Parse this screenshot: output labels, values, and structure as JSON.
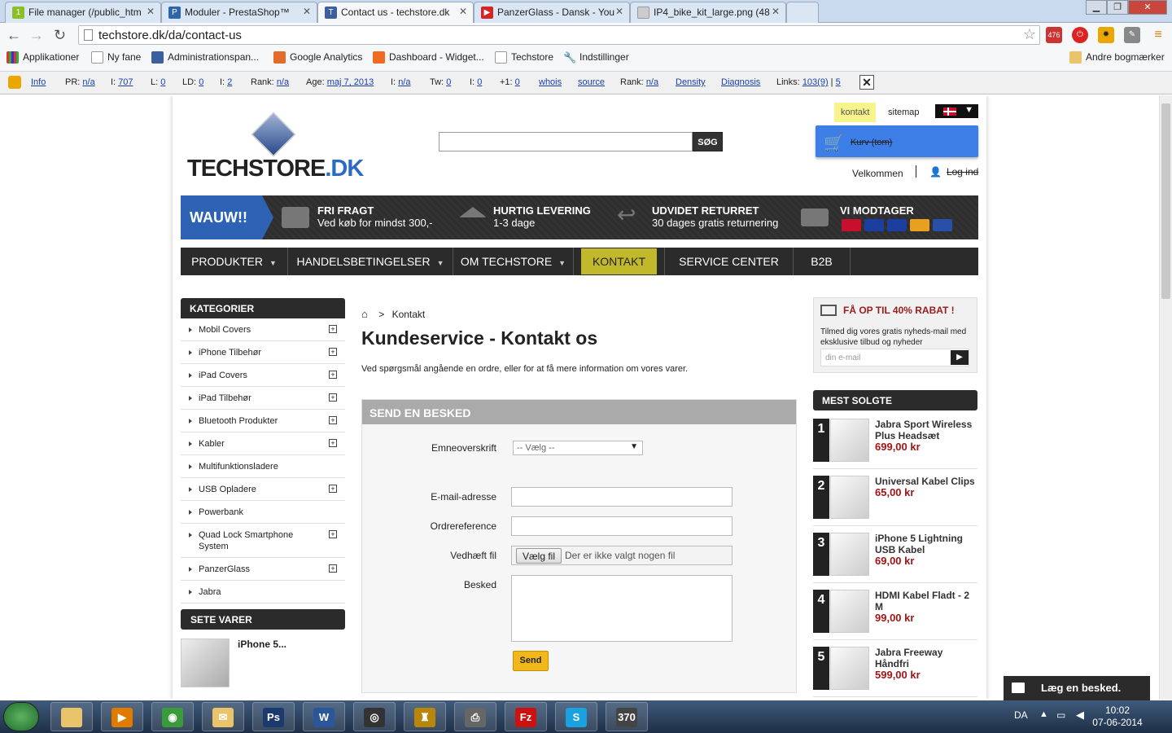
{
  "browser": {
    "tabs": [
      {
        "title": "File manager (/public_htm",
        "fav": "1",
        "color": "#8cbf26"
      },
      {
        "title": "Moduler - PrestaShop™",
        "fav": "P",
        "color": "#2f66a9"
      },
      {
        "title": "Contact us - techstore.dk",
        "fav": "T",
        "color": "#3d5fa0",
        "active": true
      },
      {
        "title": "PanzerGlass - Dansk - You",
        "fav": "▶",
        "color": "#d42424"
      },
      {
        "title": "IP4_bike_kit_large.png (48",
        "fav": "",
        "color": "#cccccc"
      }
    ],
    "url": "techstore.dk/da/contact-us",
    "ext_badge": "476",
    "bookmarks": [
      "Applikationer",
      "Ny fane",
      "Administrationspan...",
      "Google Analytics",
      "Dashboard - Widget...",
      "Techstore",
      "Indstillinger"
    ],
    "other_bookmarks": "Andre bogmærker"
  },
  "seo": {
    "info": "Info",
    "pr_label": "PR:",
    "pr": "n/a",
    "i_label": "I:",
    "i": "707",
    "l_label": "L:",
    "l": "0",
    "ld_label": "LD:",
    "ld": "0",
    "i2_label": "I:",
    "i2": "2",
    "rank_label": "Rank:",
    "rank": "n/a",
    "age_label": "Age:",
    "age": "maj 7, 2013",
    "i3_label": "I:",
    "i3": "n/a",
    "tw_label": "Tw:",
    "tw": "0",
    "fb_label": "I:",
    "fb": "0",
    "plus_label": "+1:",
    "plus": "0",
    "whois": "whois",
    "source": "source",
    "rank2_label": "Rank:",
    "rank2": "n/a",
    "density": "Density",
    "diagnosis": "Diagnosis",
    "links_label": "Links:",
    "links": "103(9)",
    "links2": "5"
  },
  "header": {
    "logo_main": "TECHSTORE",
    "logo_suffix": ".DK",
    "search_button": "SØG",
    "contact_link": "kontakt",
    "sitemap_link": "sitemap",
    "cart": "Kurv (tom)",
    "welcome": "Velkommen",
    "login": "Log ind"
  },
  "banner": {
    "wauw": "WAUW!!",
    "features": [
      {
        "title": "FRI FRAGT",
        "text": "Ved køb for mindst 300,-"
      },
      {
        "title": "HURTIG LEVERING",
        "text": "1-3 dage"
      },
      {
        "title": "UDVIDET RETURRET",
        "text": "30 dages gratis returnering"
      },
      {
        "title": "VI MODTAGER",
        "text": ""
      }
    ],
    "cards": [
      {
        "name": "DK",
        "color": "#c8102e"
      },
      {
        "name": "VISA",
        "color": "#1a3fa0"
      },
      {
        "name": "VISA",
        "color": "#1a3fa0"
      },
      {
        "name": "MC",
        "color": "#e8a020"
      },
      {
        "name": "Maestro",
        "color": "#2850a8"
      }
    ]
  },
  "nav": [
    "PRODUKTER",
    "HANDELSBETINGELSER",
    "OM TECHSTORE",
    "KONTAKT",
    "SERVICE CENTER",
    "B2B"
  ],
  "categories": {
    "title": "KATEGORIER",
    "items": [
      {
        "label": "Mobil Covers",
        "plus": true
      },
      {
        "label": "iPhone Tilbehør",
        "plus": true
      },
      {
        "label": "iPad Covers",
        "plus": true
      },
      {
        "label": "iPad Tilbehør",
        "plus": true
      },
      {
        "label": "Bluetooth Produkter",
        "plus": true
      },
      {
        "label": "Kabler",
        "plus": true
      },
      {
        "label": "Multifunktionsladere",
        "plus": false
      },
      {
        "label": "USB Opladere",
        "plus": true
      },
      {
        "label": "Powerbank",
        "plus": false
      },
      {
        "label": "Quad Lock Smartphone System",
        "plus": true
      },
      {
        "label": "PanzerGlass",
        "plus": true
      },
      {
        "label": "Jabra",
        "plus": false
      }
    ]
  },
  "seen": {
    "title": "SETE VARER",
    "item": "iPhone 5..."
  },
  "main": {
    "breadcrumb_sep": ">",
    "breadcrumb": "Kontakt",
    "title": "Kundeservice - Kontakt os",
    "intro": "Ved spørgsmål angående en ordre, eller for at få mere information om vores varer.",
    "form_title": "SEND EN BESKED",
    "subject_label": "Emneoverskrift",
    "subject_value": "-- Vælg --",
    "email_label": "E-mail-adresse",
    "order_label": "Ordrereference",
    "file_label": "Vedhæft fil",
    "file_button": "Vælg fil",
    "file_none": "Der er ikke valgt nogen fil",
    "message_label": "Besked",
    "send": "Send"
  },
  "newsletter": {
    "title": "FÅ OP TIL 40% RABAT !",
    "text": "Tilmed dig vores gratis nyheds-mail med eksklusive tilbud og nyheder",
    "placeholder": "din e-mail"
  },
  "bestsellers": {
    "title": "MEST SOLGTE",
    "items": [
      {
        "num": "1",
        "name": "Jabra Sport Wireless Plus Headsæt",
        "price": "699,00 kr"
      },
      {
        "num": "2",
        "name": "Universal Kabel Clips",
        "price": "65,00 kr"
      },
      {
        "num": "3",
        "name": "iPhone 5 Lightning USB Kabel",
        "price": "69,00 kr"
      },
      {
        "num": "4",
        "name": "HDMI Kabel Fladt - 2 M",
        "price": "99,00 kr"
      },
      {
        "num": "5",
        "name": "Jabra Freeway Håndfri",
        "price": "599,00 kr"
      }
    ]
  },
  "chat": "Læg en besked.",
  "taskbar": {
    "apps": [
      "explorer",
      "media",
      "chrome",
      "mail",
      "Ps",
      "W",
      "steam",
      "game",
      "fax",
      "Fz",
      "S",
      "370"
    ],
    "lang": "DA",
    "time": "10:02",
    "date": "07-06-2014"
  }
}
